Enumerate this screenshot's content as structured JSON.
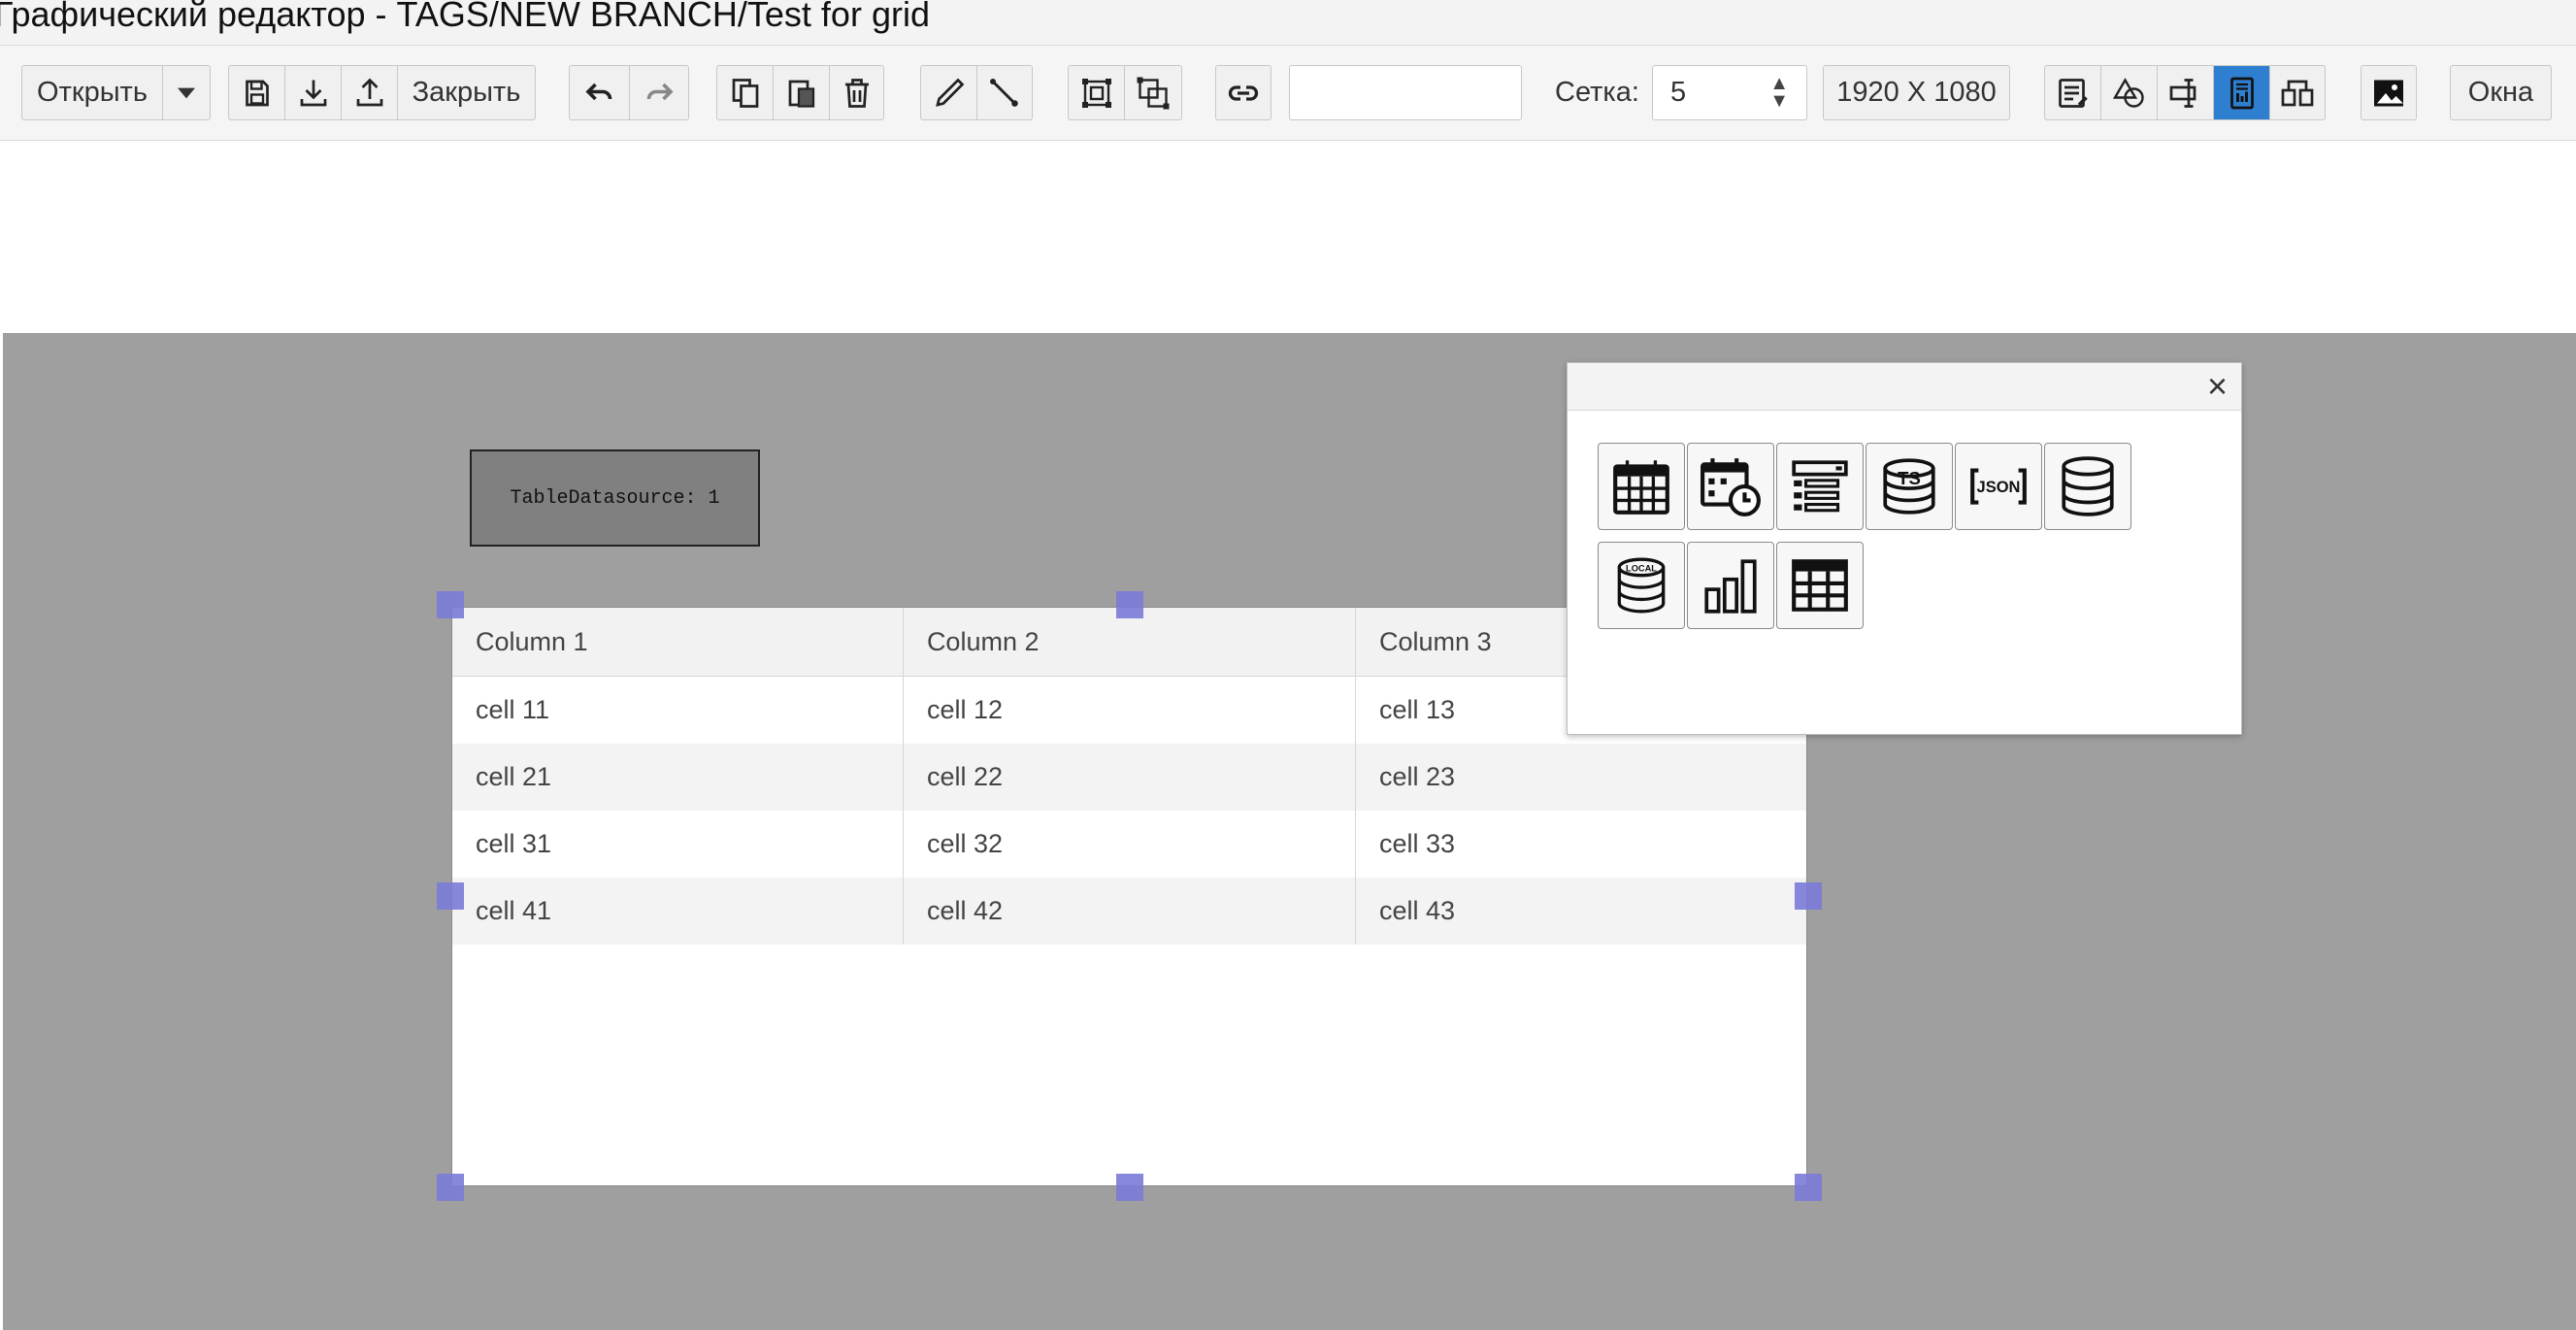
{
  "window": {
    "title": "Графический редактор - TAGS/NEW BRANCH/Test for grid"
  },
  "toolbar": {
    "open_label": "Открыть",
    "close_label": "Закрыть",
    "link_input_value": "",
    "grid_label": "Сетка:",
    "grid_value": "5",
    "resolution": "1920 X 1080",
    "windows_label": "Окна"
  },
  "canvas": {
    "datasource_label": "TableDatasource: 1",
    "grid": {
      "columns": [
        "Column 1",
        "Column 2",
        "Column 3"
      ],
      "rows": [
        [
          "cell 11",
          "cell 12",
          "cell 13"
        ],
        [
          "cell 21",
          "cell 22",
          "cell 23"
        ],
        [
          "cell 31",
          "cell 32",
          "cell 33"
        ],
        [
          "cell 41",
          "cell 42",
          "cell 43"
        ]
      ]
    }
  },
  "palette": {
    "close_icon": "×",
    "tools": [
      "table-calendar-icon",
      "calendar-clock-icon",
      "list-icon",
      "ts-database-icon",
      "json-icon",
      "database-icon",
      "local-database-icon",
      "bar-chart-icon",
      "grid-table-icon"
    ]
  },
  "colors": {
    "active": "#2f7fd1",
    "canvas": "#9f9f9f",
    "handle": "#7a7ad8"
  }
}
